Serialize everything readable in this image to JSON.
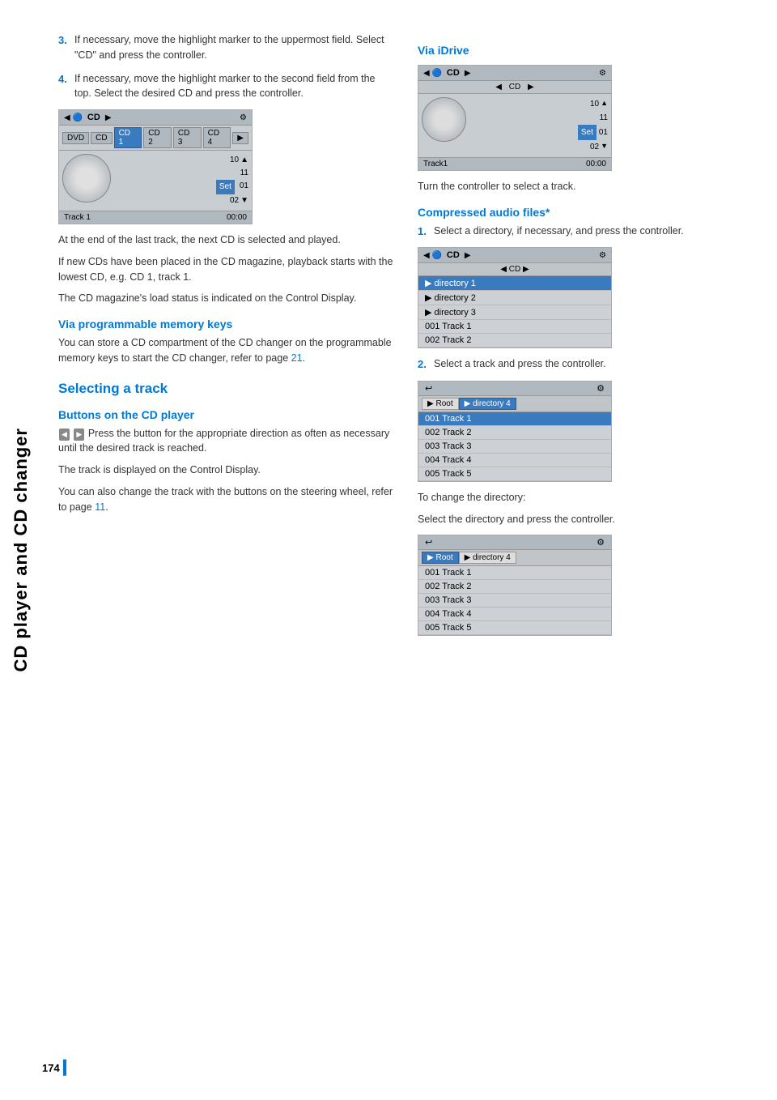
{
  "sidebar": {
    "label": "CD player and CD changer"
  },
  "page_number": "174",
  "left_col": {
    "step3": {
      "num": "3.",
      "text": "If necessary, move the highlight marker to the uppermost field. Select \"CD\" and press the controller."
    },
    "step4": {
      "num": "4.",
      "text": "If necessary, move the highlight marker to the second field from the top. Select the desired CD and press the controller."
    },
    "cd_ui": {
      "top_label": "CD",
      "tabs": [
        "DVD",
        "CD",
        "CD 1",
        "CD 2",
        "CD 3",
        "CD 4"
      ],
      "tracks": [
        "10",
        "11",
        "01",
        "02"
      ],
      "set_label": "Set",
      "footer_left": "Track 1",
      "footer_right": "00:00"
    },
    "para1": "At the end of the last track, the next CD is selected and played.",
    "para2": "If new CDs have been placed in the CD magazine, playback starts with the lowest CD, e.g. CD 1, track 1.",
    "para3": "The CD magazine's load status is indicated on the Control Display.",
    "via_prog_heading": "Via programmable memory keys",
    "via_prog_text": "You can store a CD compartment of the CD changer on the programmable memory keys to start the CD changer, refer to page",
    "via_prog_page": "21",
    "selecting_heading": "Selecting a track",
    "buttons_heading": "Buttons on the CD player",
    "buttons_text": "Press the button for the appropriate direction as often as necessary until the desired track is reached.",
    "buttons_text2": "The track is displayed on the Control Display.",
    "buttons_text3": "You can also change the track with the buttons on the steering wheel, refer to page",
    "buttons_page": "11"
  },
  "right_col": {
    "via_idrive_heading": "Via iDrive",
    "idrive_ui": {
      "top_label": "CD",
      "sub_label": "CD",
      "tracks": [
        "10",
        "11",
        "01",
        "02"
      ],
      "set_label": "Set",
      "footer_left": "Track1",
      "footer_right": "00:00"
    },
    "idrive_text": "Turn the controller to select a track.",
    "compressed_heading": "Compressed audio files*",
    "step1": {
      "num": "1.",
      "text": "Select a directory, if necessary, and press the controller."
    },
    "dir_ui": {
      "top_label": "CD",
      "sub_label": "CD",
      "items": [
        {
          "label": "▶ directory 1",
          "selected": true
        },
        {
          "label": "▶ directory 2",
          "selected": false
        },
        {
          "label": "▶ directory 3",
          "selected": false
        },
        {
          "label": "001 Track  1",
          "selected": false
        },
        {
          "label": "002 Track  2",
          "selected": false
        }
      ]
    },
    "step2": {
      "num": "2.",
      "text": "Select a track and press the controller."
    },
    "track_ui1": {
      "breadcrumb": [
        "▶ Root",
        "▶ directory 4"
      ],
      "items": [
        {
          "label": "001 Track  1",
          "selected": true
        },
        {
          "label": "002 Track  2",
          "selected": false
        },
        {
          "label": "003 Track  3",
          "selected": false
        },
        {
          "label": "004 Track  4",
          "selected": false
        },
        {
          "label": "005 Track  5",
          "selected": false
        }
      ]
    },
    "change_dir_text1": "To change the directory:",
    "change_dir_text2": "Select the directory and press the controller.",
    "track_ui2": {
      "breadcrumb": [
        "▶ Root",
        "▶ directory 4"
      ],
      "items": [
        {
          "label": "001 Track  1",
          "selected": false
        },
        {
          "label": "002 Track  2",
          "selected": false
        },
        {
          "label": "003 Track  3",
          "selected": false
        },
        {
          "label": "004 Track  4",
          "selected": false
        },
        {
          "label": "005 Track  5",
          "selected": false
        }
      ]
    }
  }
}
